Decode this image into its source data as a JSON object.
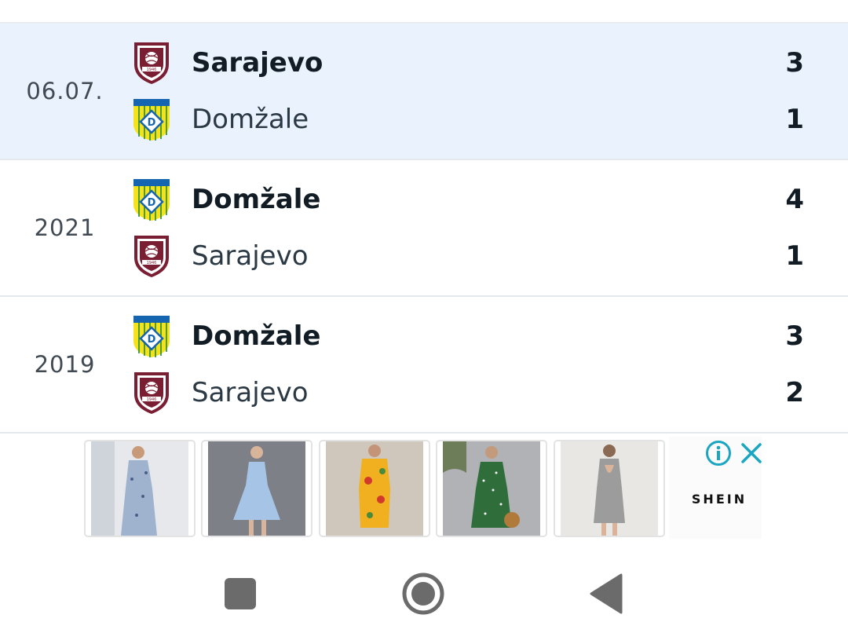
{
  "matches": [
    {
      "date": "06.07.",
      "highlighted": true,
      "home": {
        "name": "Sarajevo",
        "score": "3",
        "logo": "sarajevo-crest-icon"
      },
      "away": {
        "name": "Domžale",
        "score": "1",
        "logo": "domzale-crest-icon"
      }
    },
    {
      "date": "2021",
      "highlighted": false,
      "home": {
        "name": "Domžale",
        "score": "4",
        "logo": "domzale-crest-icon"
      },
      "away": {
        "name": "Sarajevo",
        "score": "1",
        "logo": "sarajevo-crest-icon"
      }
    },
    {
      "date": "2019",
      "highlighted": false,
      "home": {
        "name": "Domžale",
        "score": "3",
        "logo": "domzale-crest-icon"
      },
      "away": {
        "name": "Sarajevo",
        "score": "2",
        "logo": "sarajevo-crest-icon"
      }
    }
  ],
  "ad": {
    "brand": "SHEIN",
    "icons": [
      "info-icon",
      "close-icon"
    ],
    "products": [
      {
        "dress": "blue-floral-dress",
        "color": "#9fb3cf"
      },
      {
        "dress": "light-blue-dress",
        "color": "#a6c4e6"
      },
      {
        "dress": "yellow-floral-dress",
        "color": "#f0b020"
      },
      {
        "dress": "green-polka-dot-dress",
        "color": "#2f6e3a"
      },
      {
        "dress": "grey-sequin-dress",
        "color": "#9c9c9c"
      }
    ]
  },
  "colors": {
    "highlight_row": "#eaf3fd",
    "sarajevo_maroon": "#7a1e33",
    "domzale_yellow": "#f5e21b",
    "domzale_blue": "#1565b0",
    "ad_icon_teal": "#1aa6c2",
    "nav_grey": "#6b6b6b"
  },
  "navigation": {
    "recents": "square-icon",
    "home": "circle-icon",
    "back": "triangle-back-icon"
  }
}
